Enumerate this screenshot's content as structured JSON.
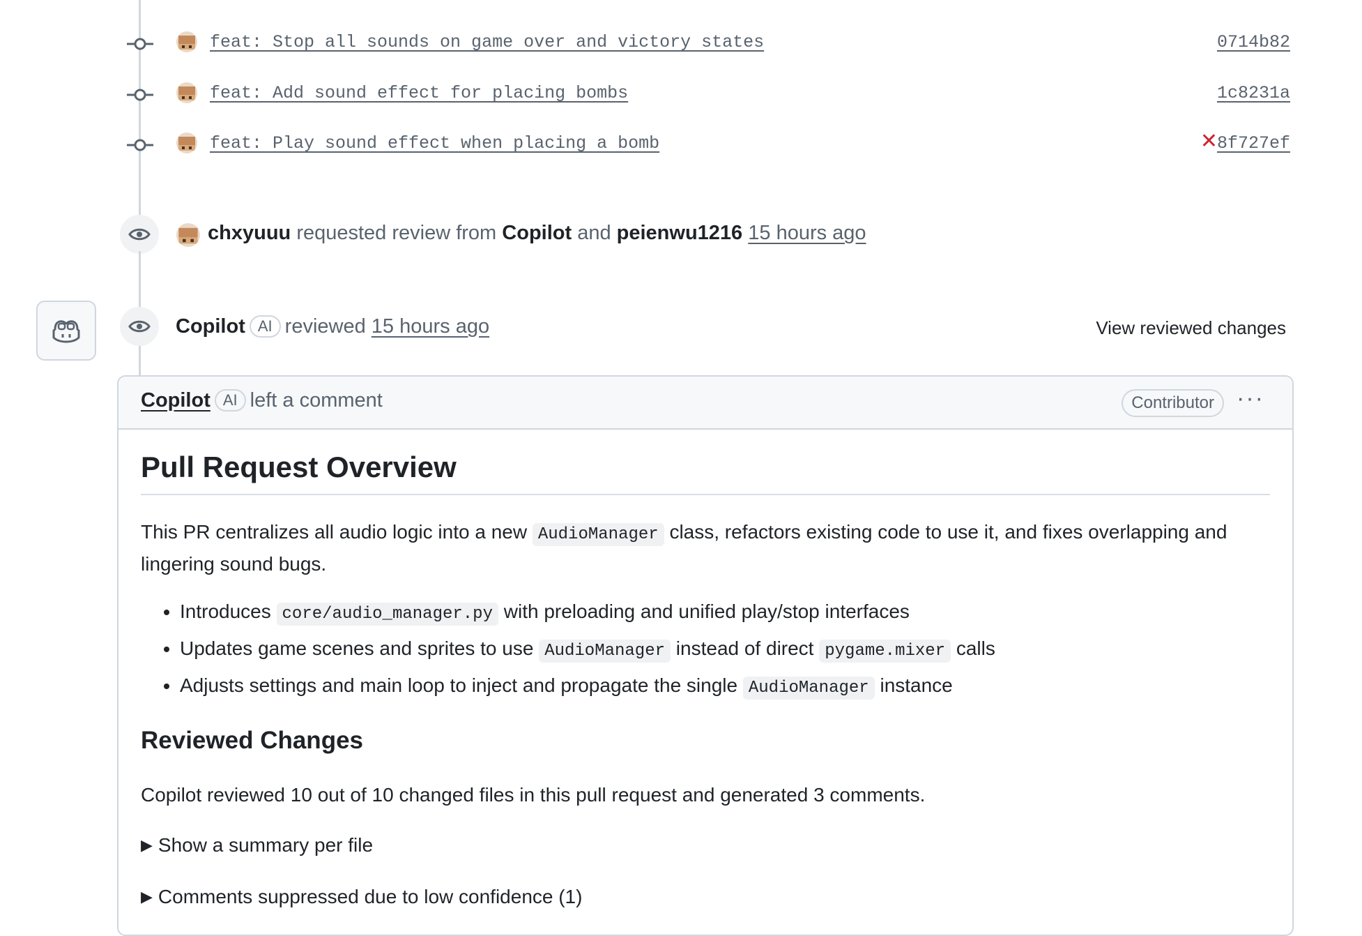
{
  "commits": [
    {
      "message": "feat: Stop all sounds on game over and victory states",
      "sha": "0714b82",
      "failed": false
    },
    {
      "message": "feat: Add sound effect for placing bombs",
      "sha": "1c8231a",
      "failed": false
    },
    {
      "message": "feat: Play sound effect when placing a bomb",
      "sha": "8f727ef",
      "failed": true
    }
  ],
  "review_request": {
    "actor": "chxyuuu",
    "verb": "requested review from",
    "reviewer1": "Copilot",
    "conj": "and",
    "reviewer2": "peienwu1216",
    "time": "15 hours ago"
  },
  "review_event": {
    "actor": "Copilot",
    "ai_label": "AI",
    "verb": "reviewed",
    "time": "15 hours ago",
    "view_changes_label": "View reviewed changes"
  },
  "comment": {
    "author": "Copilot",
    "ai_label": "AI",
    "action": "left a comment",
    "role_badge": "Contributor",
    "more_label": "···",
    "heading": "Pull Request Overview",
    "intro_before": "This PR centralizes all audio logic into a new ",
    "intro_code": "AudioManager",
    "intro_after": " class, refactors existing code to use it, and fixes overlapping and lingering sound bugs.",
    "bullets": [
      {
        "before": "Introduces ",
        "code": "core/audio_manager.py",
        "after": " with preloading and unified play/stop interfaces"
      },
      {
        "before": "Updates game scenes and sprites to use ",
        "code": "AudioManager",
        "mid": " instead of direct ",
        "code2": "pygame.mixer",
        "after": " calls"
      },
      {
        "before": "Adjusts settings and main loop to inject and propagate the single ",
        "code": "AudioManager",
        "after": " instance"
      }
    ],
    "subheading": "Reviewed Changes",
    "summary": "Copilot reviewed 10 out of 10 changed files in this pull request and generated 3 comments.",
    "details": [
      "Show a summary per file",
      "Comments suppressed due to low confidence (1)"
    ]
  }
}
